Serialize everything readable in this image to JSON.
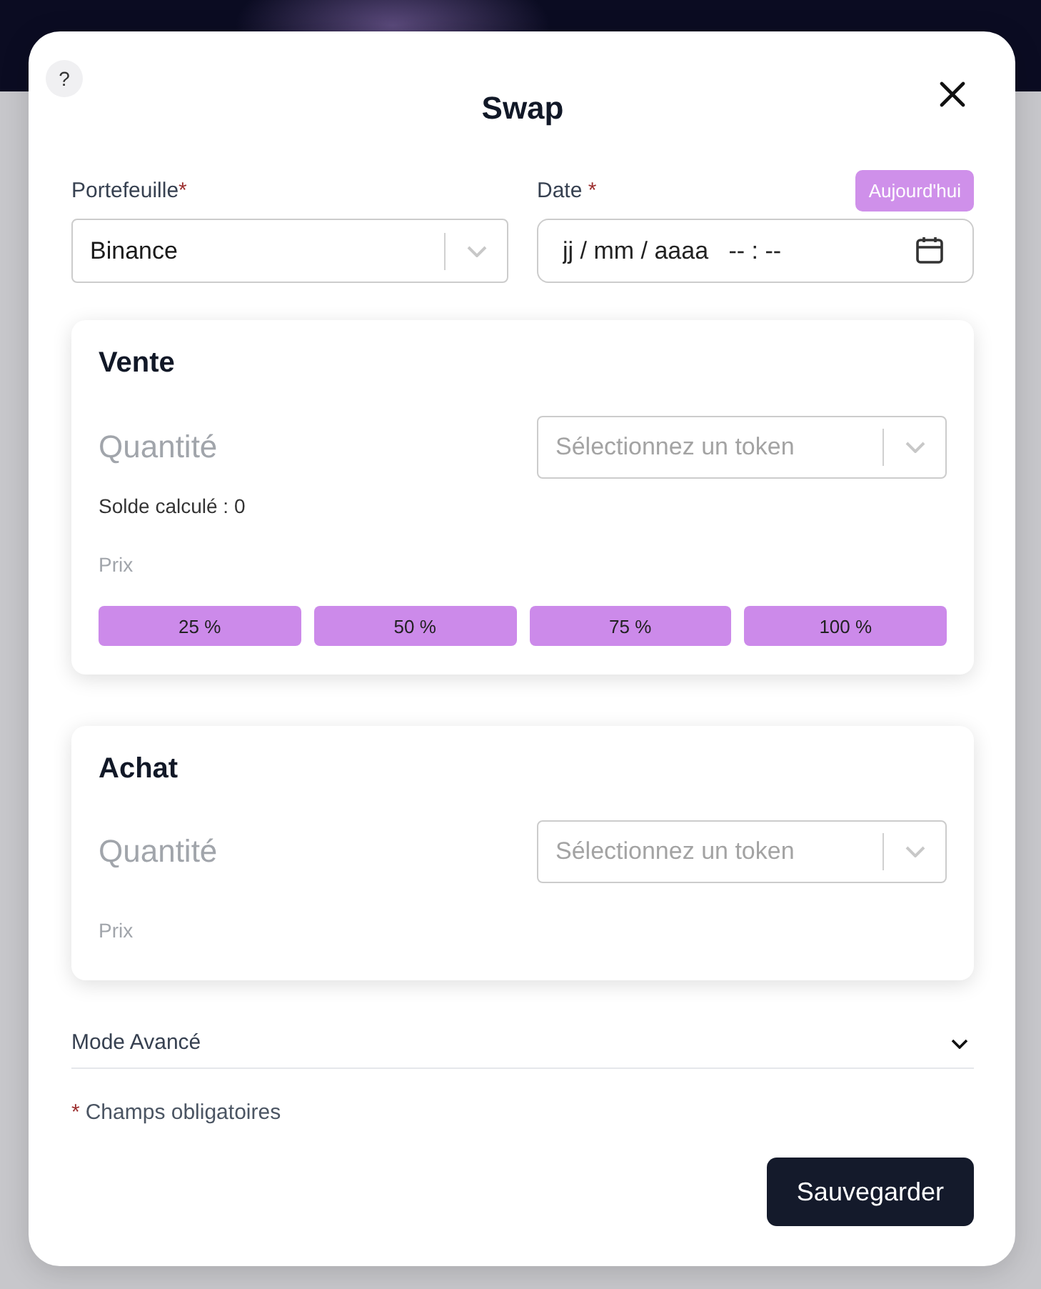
{
  "help_button": {
    "label": "?"
  },
  "title": "Swap",
  "wallet": {
    "label": "Portefeuille",
    "required_mark": "*",
    "value": "Binance"
  },
  "date": {
    "label": "Date",
    "required_mark": " *",
    "today_button": "Aujourd'hui",
    "placeholder": "jj / mm / aaaa   -- : --"
  },
  "sections": [
    {
      "title": "Vente",
      "quantity_placeholder": "Quantité",
      "token_placeholder": "Sélectionnez un token",
      "balance": "Solde calculé : 0",
      "price_placeholder": "Prix",
      "percent_buttons": [
        "25 %",
        "50 %",
        "75 %",
        "100 %"
      ]
    },
    {
      "title": "Achat",
      "quantity_placeholder": "Quantité",
      "token_placeholder": "Sélectionnez un token",
      "price_placeholder": "Prix"
    }
  ],
  "advanced": {
    "label": "Mode Avancé",
    "expanded": false
  },
  "required_note": {
    "mark": "*",
    "text": "Champs obligatoires"
  },
  "save_button": "Sauvegarder"
}
